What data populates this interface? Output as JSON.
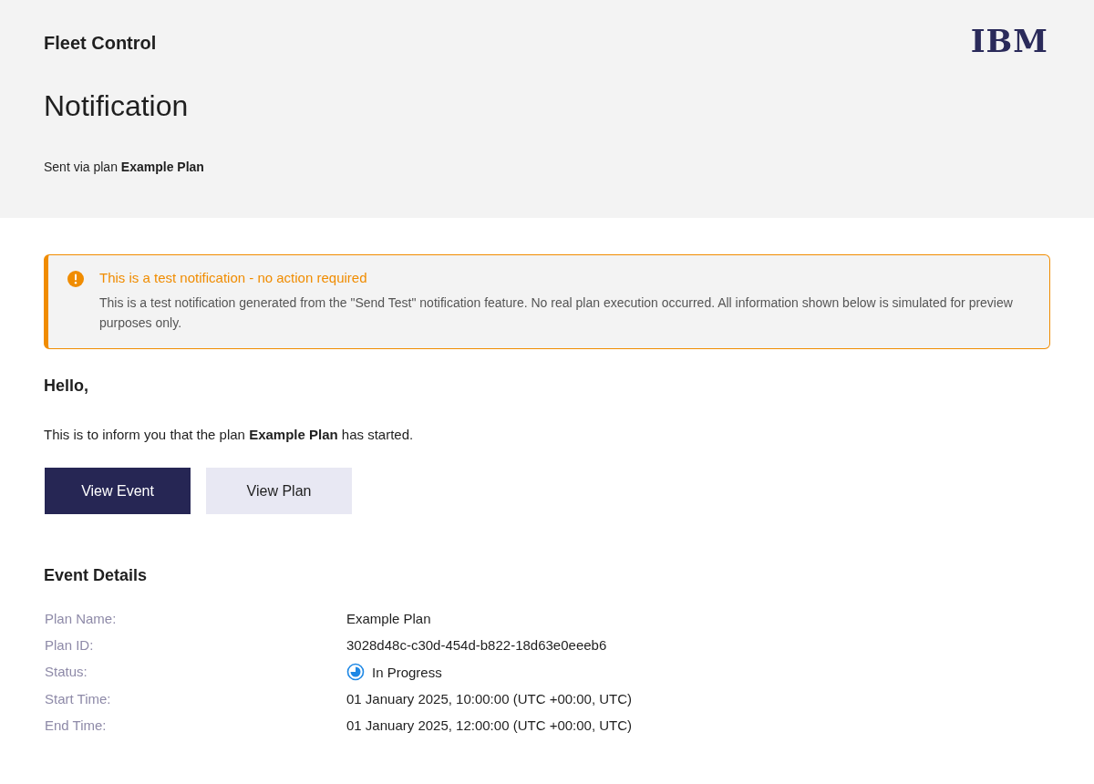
{
  "header": {
    "app_name": "Fleet Control",
    "logo": "IBM",
    "title": "Notification",
    "subtitle": "Sent via plan **Example Plan**"
  },
  "alert": {
    "kind": "warning",
    "title": "This is a test notification - no action required",
    "message": "This is a test notification generated from the \"Send Test\" notification feature. No real plan execution occurred. All information shown below is simulated for preview purposes only."
  },
  "greeting": "Hello,",
  "intro": "This is to inform you that the plan **Example Plan** has started.",
  "buttons": [
    {
      "label": "View Event",
      "kind": "primary"
    },
    {
      "label": "View Plan",
      "kind": "secondary"
    }
  ],
  "details": {
    "title": "Event Details",
    "rows": [
      {
        "label": "Plan Name:",
        "value": "Example Plan"
      },
      {
        "label": "Plan ID:",
        "value": "3028d48c-c30d-454d-b822-18d63e0eeeb6"
      },
      {
        "label": "Status:",
        "value": "In Progress",
        "kind": "in_progress"
      },
      {
        "label": "Start Time:",
        "value": "01 January 2025, 10:00:00 (UTC +00:00, UTC)"
      },
      {
        "label": "End Time:",
        "value": "01 January 2025, 12:00:00 (UTC +00:00, UTC)"
      }
    ]
  }
}
